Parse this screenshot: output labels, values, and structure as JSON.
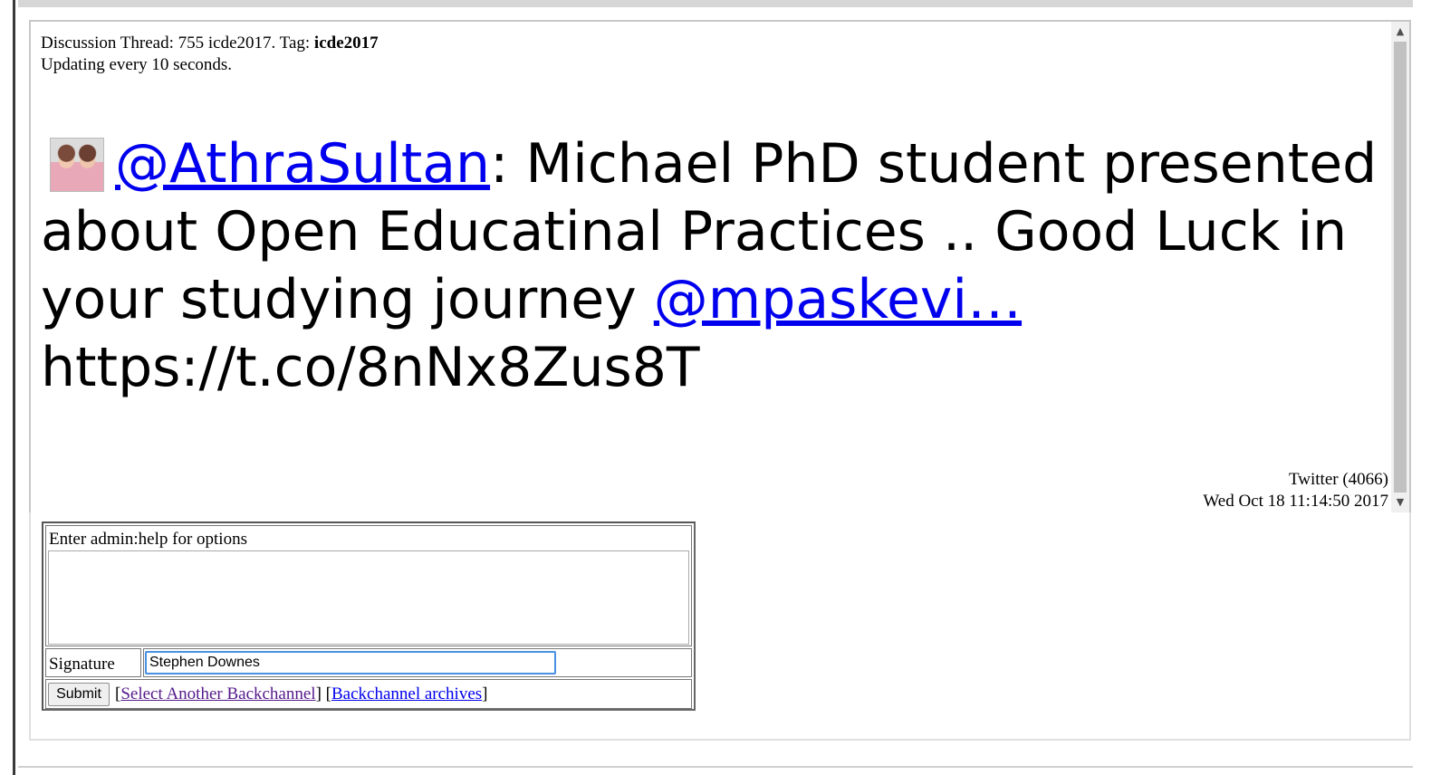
{
  "thread": {
    "prefix": "Discussion Thread: 755 icde2017. Tag: ",
    "tag": "icde2017",
    "update_status": "Updating every 10 seconds."
  },
  "post": {
    "author_handle": "@AthraSultan",
    "text_part1": ": Michael PhD student presented about Open Educatinal Practices .. Good Luck in your studying journey ",
    "mention": "@mpaskevi…",
    "text_part2": " https://t.co/8nNx8Zus8T",
    "source": "Twitter (4066)",
    "timestamp": "Wed Oct 18 11:14:50 2017"
  },
  "form": {
    "help_label": "Enter admin:help for options",
    "message_value": "",
    "signature_label": "Signature",
    "signature_value": "Stephen Downes",
    "submit_label": "Submit",
    "link_select": "Select Another Backchannel",
    "link_archives": "Backchannel archives"
  },
  "colors": {
    "link": "#0000ee",
    "visited_link": "#551a8b",
    "focus_border": "#4a90e2"
  }
}
